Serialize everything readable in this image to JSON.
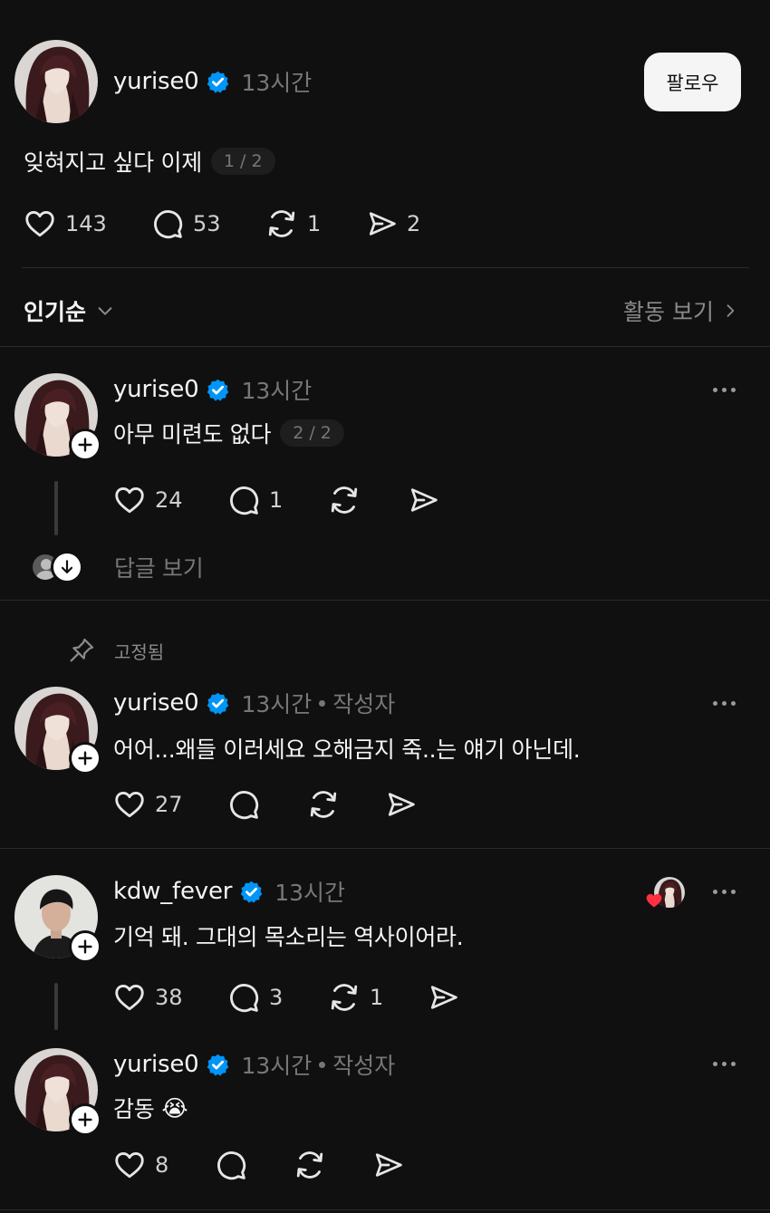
{
  "original_post": {
    "username": "yurise0",
    "time": "13시간",
    "text": "잊혀지고 싶다 이제",
    "pager": "1 / 2",
    "likes": "143",
    "comments": "53",
    "reposts": "1",
    "shares": "2",
    "follow_label": "팔로우"
  },
  "sort": {
    "label": "인기순",
    "activity_label": "활동 보기"
  },
  "replies": [
    {
      "username": "yurise0",
      "time": "13시간",
      "text": "아무 미련도 없다",
      "pager": "2 / 2",
      "likes": "24",
      "comments": "1",
      "view_replies": "답글 보기"
    },
    {
      "pinned_label": "고정됨",
      "username": "yurise0",
      "time": "13시간",
      "author_tag": "작성자",
      "text": "어어...왜들 이러세요 오해금지 죽..는 얘기 아닌데.",
      "likes": "27"
    },
    {
      "username": "kdw_fever",
      "time": "13시간",
      "text": "기억 돼. 그대의 목소리는 역사이어라.",
      "likes": "38",
      "comments": "3",
      "reposts": "1"
    },
    {
      "username": "yurise0",
      "time": "13시간",
      "author_tag": "작성자",
      "text": "감동",
      "emoji": "😭",
      "likes": "8"
    }
  ],
  "colors": {
    "background": "#101010",
    "verified": "#0095f6",
    "heart_badge": "#ff3040"
  }
}
